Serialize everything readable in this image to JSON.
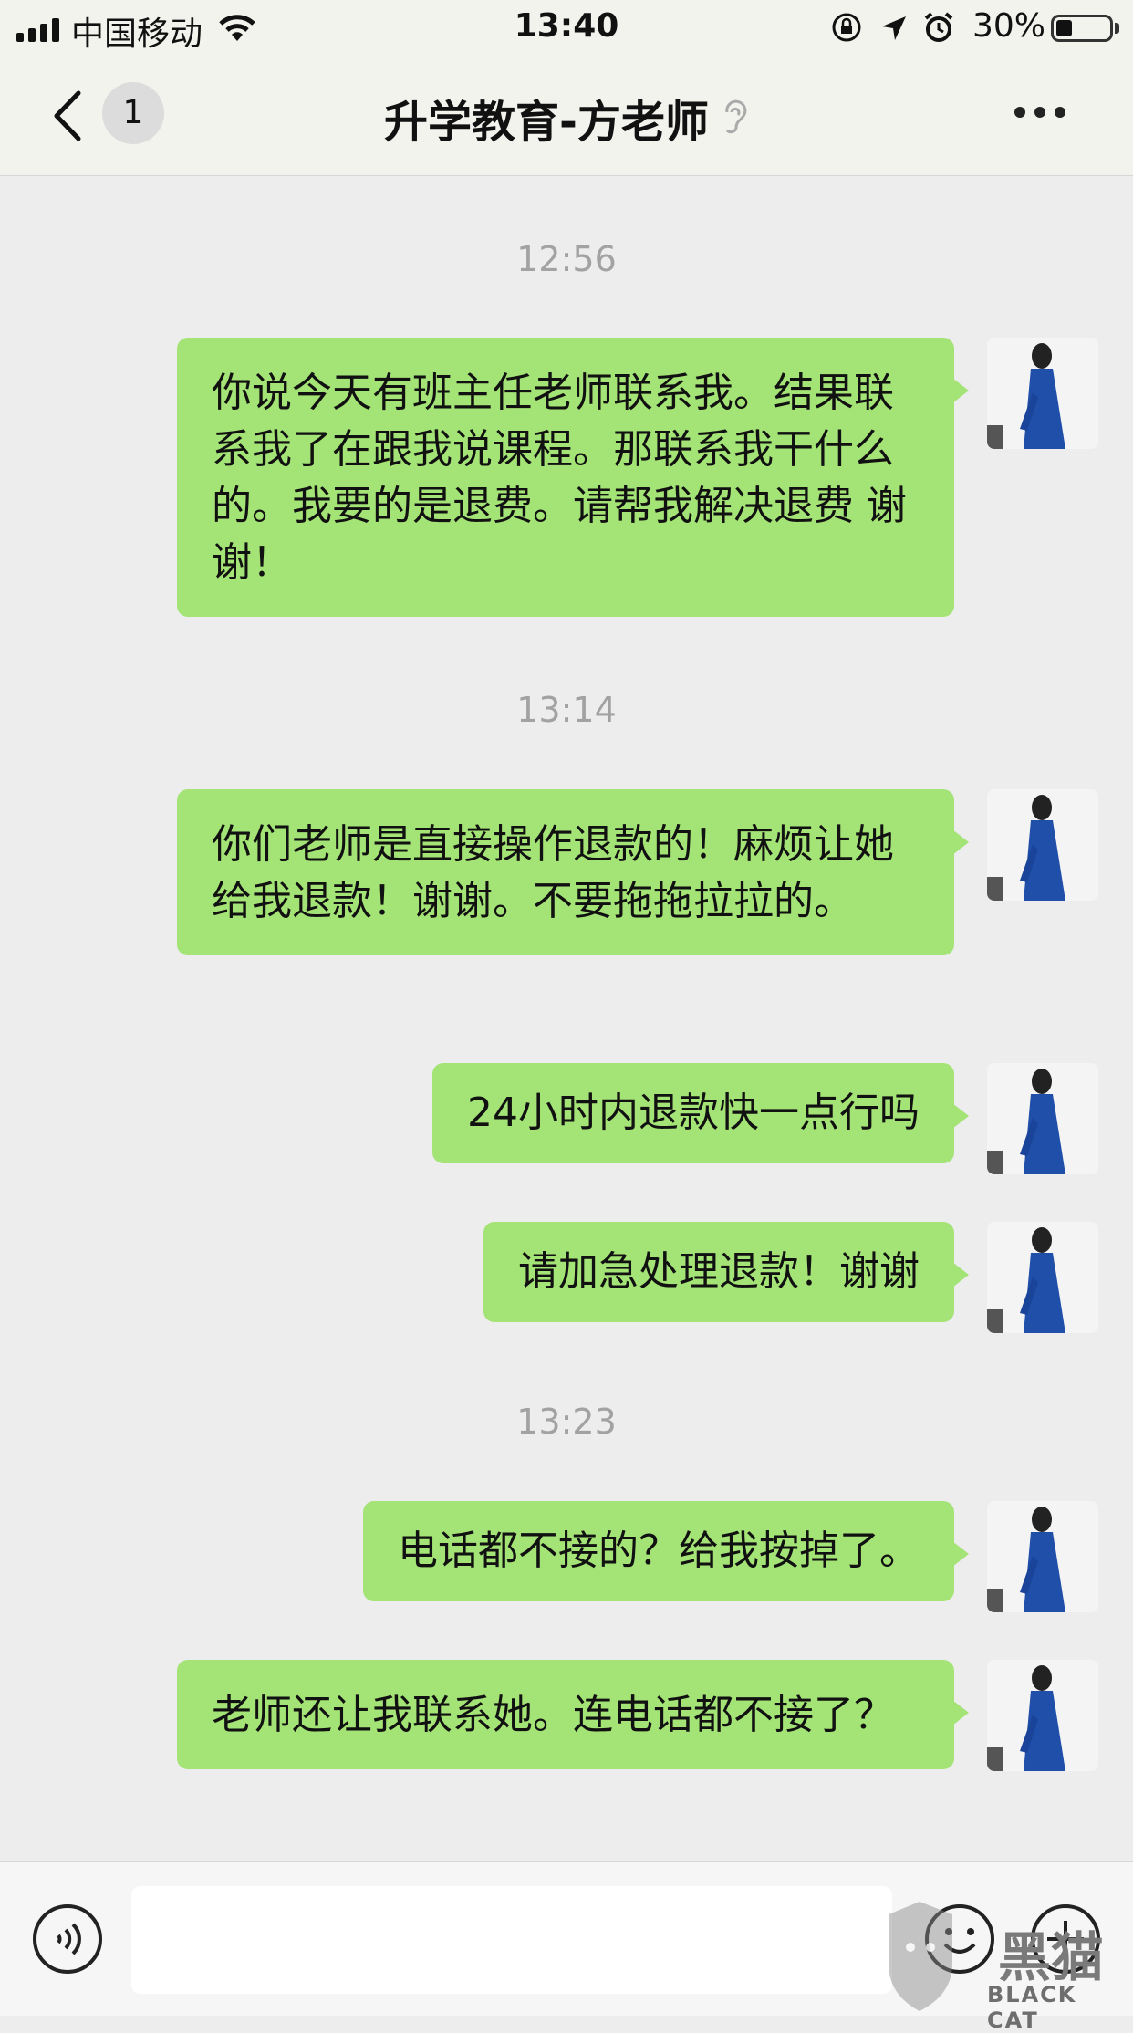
{
  "status_bar": {
    "carrier": "中国移动",
    "time": "13:40",
    "battery": "30%",
    "battery_level": 0.3,
    "icons": [
      "signal-icon",
      "wifi-icon",
      "rotation-lock-icon",
      "location-icon",
      "alarm-icon",
      "battery-icon"
    ]
  },
  "header": {
    "unread_count": "1",
    "title": "升学教育-方老师",
    "icons": [
      "back-icon",
      "earpiece-icon",
      "more-icon"
    ]
  },
  "messages": [
    {
      "timestamp": "12:56"
    },
    {
      "text": "你说今天有班主任老师联系我。结果联系我了在跟我说课程。那联系我干什么的。我要的是退费。请帮我解决退费 谢谢！"
    },
    {
      "timestamp": "13:14"
    },
    {
      "text": "你们老师是直接操作退款的！麻烦让她给我退款！谢谢。不要拖拖拉拉的。"
    },
    {
      "text": "24小时内退款快一点行吗"
    },
    {
      "text": "请加急处理退款！谢谢"
    },
    {
      "timestamp": "13:23"
    },
    {
      "text": "电话都不接的？给我按掉了。"
    },
    {
      "text": "老师还让我联系她。连电话都不接了？"
    }
  ],
  "input_bar": {
    "value": "",
    "icons": [
      "voice-icon",
      "emoji-icon",
      "plus-icon"
    ]
  },
  "watermark": {
    "cn": "黑猫",
    "en": "BLACK CAT"
  },
  "colors": {
    "bubble": "#a4e376",
    "background": "#ededed",
    "timestamp": "#a2a2a2"
  }
}
